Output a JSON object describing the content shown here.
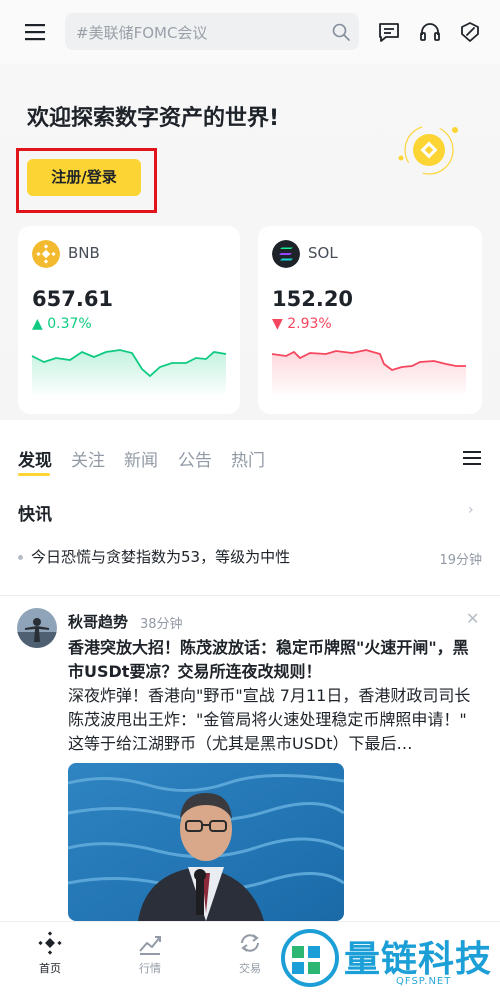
{
  "header": {
    "search_placeholder": "#美联储FOMC会议",
    "icons": [
      "menu-icon",
      "search-icon",
      "message-icon",
      "headset-icon",
      "profile-edit-icon"
    ]
  },
  "hero": {
    "welcome": "欢迎探索数字资产的世界!",
    "register_label": "注册/登录"
  },
  "markets": [
    {
      "symbol": "BNB",
      "price": "657.61",
      "change": "0.37%",
      "direction": "up",
      "color": "#0ecb81"
    },
    {
      "symbol": "SOL",
      "price": "152.20",
      "change": "2.93%",
      "direction": "down",
      "color": "#f6465d"
    }
  ],
  "tabs": [
    "发现",
    "关注",
    "新闻",
    "公告",
    "热门"
  ],
  "flash": {
    "title": "快讯",
    "items": [
      {
        "text": "今日恐慌与贪婪指数为53，等级为中性",
        "time": "19分钟"
      }
    ]
  },
  "post": {
    "author": "秋哥趋势",
    "time": "38分钟",
    "headline": "香港突放大招！陈茂波放话：稳定币牌照\"火速开闸\"，黑市USDt要凉？交易所连夜改规则！",
    "body": "深夜炸弹！香港向\"野币\"宣战 7月11日，香港财政司司长陈茂波甩出王炸：\"金管局将火速处理稳定币牌照申请！\" 这等于给江湖野币（尤其是黑市USDt）下最后…"
  },
  "bottom_nav": [
    {
      "label": "首页",
      "icon": "home-icon",
      "active": true
    },
    {
      "label": "行情",
      "icon": "markets-icon",
      "active": false
    },
    {
      "label": "交易",
      "icon": "trade-icon",
      "active": false
    }
  ],
  "watermark": {
    "text": "量链科技",
    "sub": "QFSP.NET"
  },
  "colors": {
    "brand_yellow": "#fcd535",
    "up_green": "#0ecb81",
    "down_red": "#f6465d",
    "highlight_red": "#e0151b"
  }
}
